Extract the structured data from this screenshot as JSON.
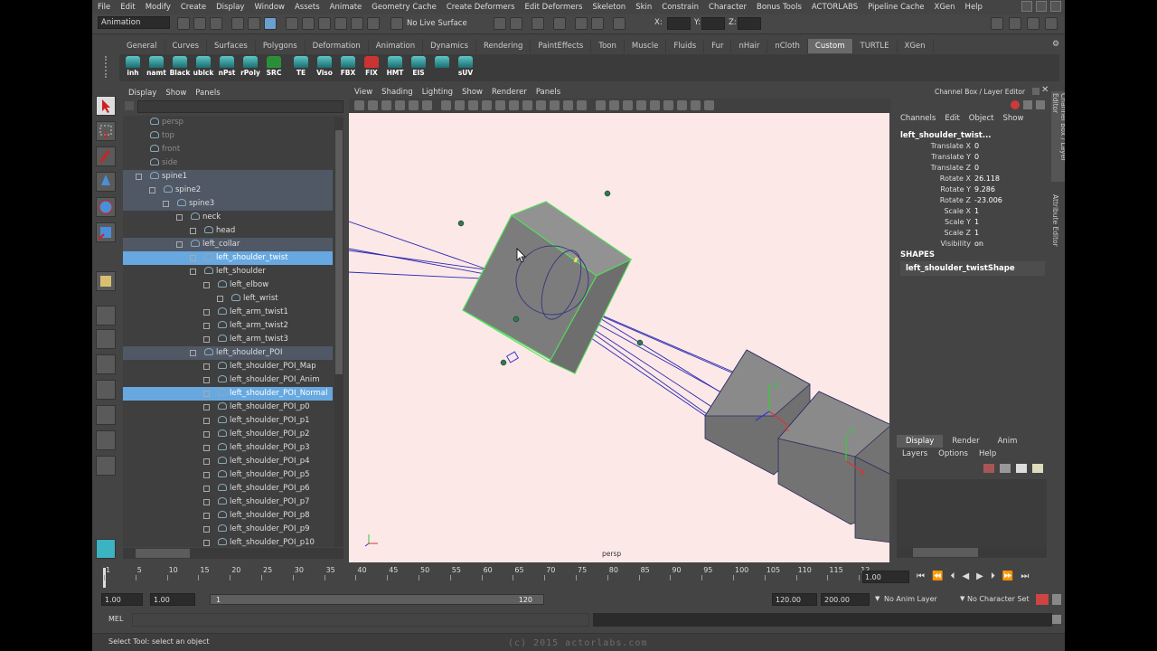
{
  "menubar": {
    "items": [
      "File",
      "Edit",
      "Modify",
      "Create",
      "Display",
      "Window",
      "Assets",
      "Animate",
      "Geometry Cache",
      "Create Deformers",
      "Edit Deformers",
      "Skeleton",
      "Skin",
      "Constrain",
      "Character",
      "Bonus Tools",
      "ACTORLABS",
      "Pipeline Cache",
      "XGen",
      "Help"
    ]
  },
  "status": {
    "mode": "Animation",
    "live_surface": "No Live Surface",
    "x_label": "X:",
    "y_label": "Y:",
    "z_label": "Z:"
  },
  "shelf": {
    "tabs": [
      "General",
      "Curves",
      "Surfaces",
      "Polygons",
      "Deformation",
      "Animation",
      "Dynamics",
      "Rendering",
      "PaintEffects",
      "Toon",
      "Muscle",
      "Fluids",
      "Fur",
      "nHair",
      "nCloth",
      "Custom",
      "TURTLE",
      "XGen"
    ],
    "active_tab": "Custom",
    "buttons": [
      "inh",
      "namt",
      "Black",
      "ublck",
      "nPst",
      "rPoly",
      "SRC",
      "TE",
      "Viso",
      "FBX",
      "FIX",
      "HMT",
      "EIS",
      "",
      "sUV"
    ]
  },
  "outliner": {
    "menu": [
      "Display",
      "Show",
      "Panels"
    ],
    "rows": [
      {
        "label": "persp",
        "indent": 0,
        "style": "dim"
      },
      {
        "label": "top",
        "indent": 0,
        "style": "dim"
      },
      {
        "label": "front",
        "indent": 0,
        "style": "dim"
      },
      {
        "label": "side",
        "indent": 0,
        "style": "dim"
      },
      {
        "label": "spine1",
        "indent": 0,
        "style": "band"
      },
      {
        "label": "spine2",
        "indent": 1,
        "style": "band"
      },
      {
        "label": "spine3",
        "indent": 2,
        "style": "band"
      },
      {
        "label": "neck",
        "indent": 3,
        "style": ""
      },
      {
        "label": "head",
        "indent": 4,
        "style": ""
      },
      {
        "label": "left_collar",
        "indent": 3,
        "style": "band"
      },
      {
        "label": "left_shoulder_twist",
        "indent": 4,
        "style": "sel"
      },
      {
        "label": "left_shoulder",
        "indent": 4,
        "style": ""
      },
      {
        "label": "left_elbow",
        "indent": 5,
        "style": ""
      },
      {
        "label": "left_wrist",
        "indent": 6,
        "style": ""
      },
      {
        "label": "left_arm_twist1",
        "indent": 5,
        "style": ""
      },
      {
        "label": "left_arm_twist2",
        "indent": 5,
        "style": ""
      },
      {
        "label": "left_arm_twist3",
        "indent": 5,
        "style": ""
      },
      {
        "label": "left_shoulder_POI",
        "indent": 4,
        "style": "band"
      },
      {
        "label": "left_shoulder_POI_Map",
        "indent": 5,
        "style": ""
      },
      {
        "label": "left_shoulder_POI_Anim",
        "indent": 5,
        "style": ""
      },
      {
        "label": "left_shoulder_POI_Normal",
        "indent": 5,
        "style": "sel"
      },
      {
        "label": "left_shoulder_POI_p0",
        "indent": 5,
        "style": ""
      },
      {
        "label": "left_shoulder_POI_p1",
        "indent": 5,
        "style": ""
      },
      {
        "label": "left_shoulder_POI_p2",
        "indent": 5,
        "style": ""
      },
      {
        "label": "left_shoulder_POI_p3",
        "indent": 5,
        "style": ""
      },
      {
        "label": "left_shoulder_POI_p4",
        "indent": 5,
        "style": ""
      },
      {
        "label": "left_shoulder_POI_p5",
        "indent": 5,
        "style": ""
      },
      {
        "label": "left_shoulder_POI_p6",
        "indent": 5,
        "style": ""
      },
      {
        "label": "left_shoulder_POI_p7",
        "indent": 5,
        "style": ""
      },
      {
        "label": "left_shoulder_POI_p8",
        "indent": 5,
        "style": ""
      },
      {
        "label": "left_shoulder_POI_p9",
        "indent": 5,
        "style": ""
      },
      {
        "label": "left_shoulder_POI_p10",
        "indent": 5,
        "style": ""
      }
    ]
  },
  "viewport": {
    "menu": [
      "View",
      "Shading",
      "Lighting",
      "Show",
      "Renderer",
      "Panels"
    ],
    "camera_label": "persp"
  },
  "channel_box": {
    "title": "Channel Box / Layer Editor",
    "menu": [
      "Channels",
      "Edit",
      "Object",
      "Show"
    ],
    "object_name": "left_shoulder_twist...",
    "channels": [
      {
        "name": "Translate X",
        "value": "0"
      },
      {
        "name": "Translate Y",
        "value": "0"
      },
      {
        "name": "Translate Z",
        "value": "0"
      },
      {
        "name": "Rotate X",
        "value": "26.118"
      },
      {
        "name": "Rotate Y",
        "value": "9.286"
      },
      {
        "name": "Rotate Z",
        "value": "-23.006"
      },
      {
        "name": "Scale X",
        "value": "1"
      },
      {
        "name": "Scale Y",
        "value": "1"
      },
      {
        "name": "Scale Z",
        "value": "1"
      },
      {
        "name": "Visibility",
        "value": "on"
      }
    ],
    "shapes_header": "SHAPES",
    "shape_name": "left_shoulder_twistShape",
    "side_tabs": [
      "Channel Box / Layer Editor",
      "Attribute Editor"
    ]
  },
  "layer_editor": {
    "tabs": [
      "Display",
      "Render",
      "Anim"
    ],
    "active_tab": "Display",
    "menu": [
      "Layers",
      "Options",
      "Help"
    ]
  },
  "timeline": {
    "ticks": [
      "1",
      "5",
      "10",
      "15",
      "20",
      "25",
      "30",
      "35",
      "40",
      "45",
      "50",
      "55",
      "60",
      "65",
      "70",
      "75",
      "80",
      "85",
      "90",
      "95",
      "100",
      "105",
      "110",
      "115",
      "12"
    ],
    "current_time": "1.00"
  },
  "range": {
    "start": "1.00",
    "playback_start": "1.00",
    "slider_start": "1",
    "slider_end": "120",
    "playback_end": "120.00",
    "end": "200.00",
    "anim_layer": "No Anim Layer",
    "character_set": "No Character Set"
  },
  "command_line": {
    "label": "MEL"
  },
  "help_line": {
    "text": "Select Tool: select an object",
    "watermark": "(c) 2015 actorlabs.com"
  }
}
